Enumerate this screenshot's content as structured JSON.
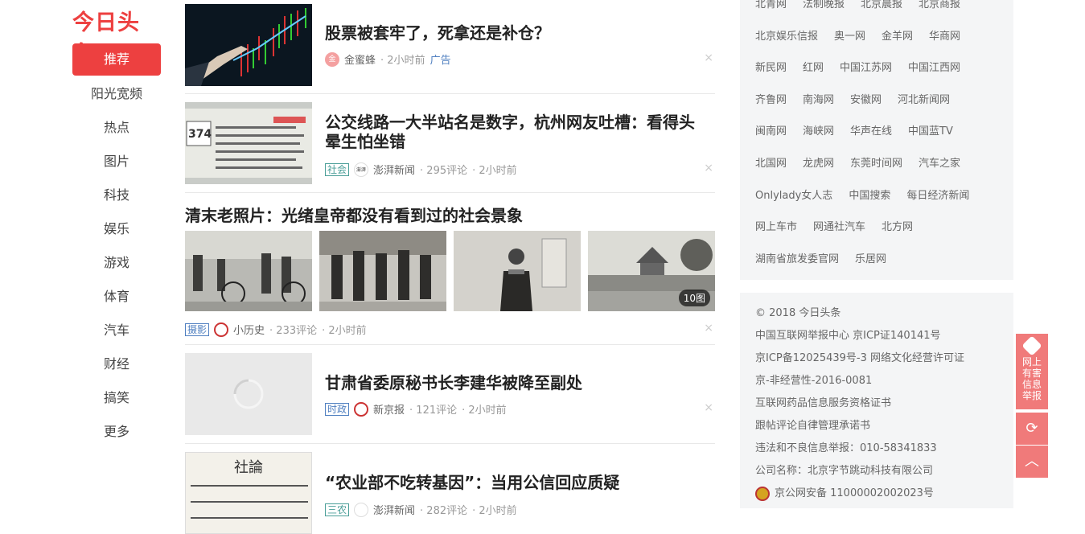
{
  "brand": {
    "logo_text": "今日头条",
    "accent": "#ed4040"
  },
  "nav": [
    {
      "label": "推荐",
      "active": true
    },
    {
      "label": "阳光宽频"
    },
    {
      "label": "热点"
    },
    {
      "label": "图片"
    },
    {
      "label": "科技"
    },
    {
      "label": "娱乐"
    },
    {
      "label": "游戏"
    },
    {
      "label": "体育"
    },
    {
      "label": "汽车"
    },
    {
      "label": "财经"
    },
    {
      "label": "搞笑"
    },
    {
      "label": "更多"
    }
  ],
  "feed": {
    "a1": {
      "title": "股票被套牢了，死拿还是补仓？",
      "source": "金蜜蜂",
      "time": "· 2小时前",
      "ad": "广告",
      "avatar": "金"
    },
    "a2": {
      "title": "公交线路一大半站名是数字，杭州网友吐槽：看得头晕生怕坐错",
      "tag": "社会",
      "source": "澎湃新闻",
      "comments": "· 295评论",
      "time": "· 2小时前",
      "avatar": "澎湃"
    },
    "a3": {
      "title": "清末老照片：光绪皇帝都没有看到过的社会景象",
      "tag": "摄影",
      "source": "小历史",
      "comments": "· 233评论",
      "time": "· 2小时前",
      "count": "10图"
    },
    "a4": {
      "title": "甘肃省委原秘书长李建华被降至副处",
      "tag": "时政",
      "source": "新京报",
      "comments": "· 121评论",
      "time": "· 2小时前"
    },
    "a5": {
      "title": "“农业部不吃转基因”：当用公信回应质疑",
      "tag": "三农",
      "source": "澎湃新闻",
      "comments": "· 282评论",
      "time": "· 2小时前",
      "thumb_text": "社論"
    },
    "close_glyph": "×"
  },
  "links": {
    "row0": [
      "北青网",
      "法制晚报",
      "北京晨报",
      "北京商报"
    ],
    "row1": [
      "北京娱乐信报",
      "奥一网",
      "金羊网",
      "华商网"
    ],
    "row2": [
      "新民网",
      "红网",
      "中国江苏网",
      "中国江西网"
    ],
    "row3": [
      "齐鲁网",
      "南海网",
      "安徽网",
      "河北新闻网"
    ],
    "row4": [
      "闽南网",
      "海峡网",
      "华声在线",
      "中国蓝TV"
    ],
    "row5": [
      "北国网",
      "龙虎网",
      "东莞时间网",
      "汽车之家"
    ],
    "row6": [
      "Onlylady女人志",
      "中国搜索",
      "每日经济新闻"
    ],
    "row7": [
      "网上车市",
      "网通社汽车",
      "北方网"
    ],
    "row8": [
      "湖南省旅发委官网",
      "乐居网"
    ]
  },
  "footer": {
    "l1": "© 2018 今日头条",
    "l2": "中国互联网举报中心 京ICP证140141号",
    "l3": "京ICP备12025439号-3 网络文化经营许可证",
    "l4": "京-非经营性-2016-0081",
    "l5": "互联网药品信息服务资格证书",
    "l6": "跟帖评论自律管理承诺书",
    "l7": "违法和不良信息举报：010-58341833",
    "l8": "公司名称：北京字节跳动科技有限公司",
    "l9": "京公网安备 11000002002023号"
  },
  "float": {
    "report_label": "网上有害信息举报",
    "refresh_icon": "⟳",
    "top_icon": "︿"
  }
}
